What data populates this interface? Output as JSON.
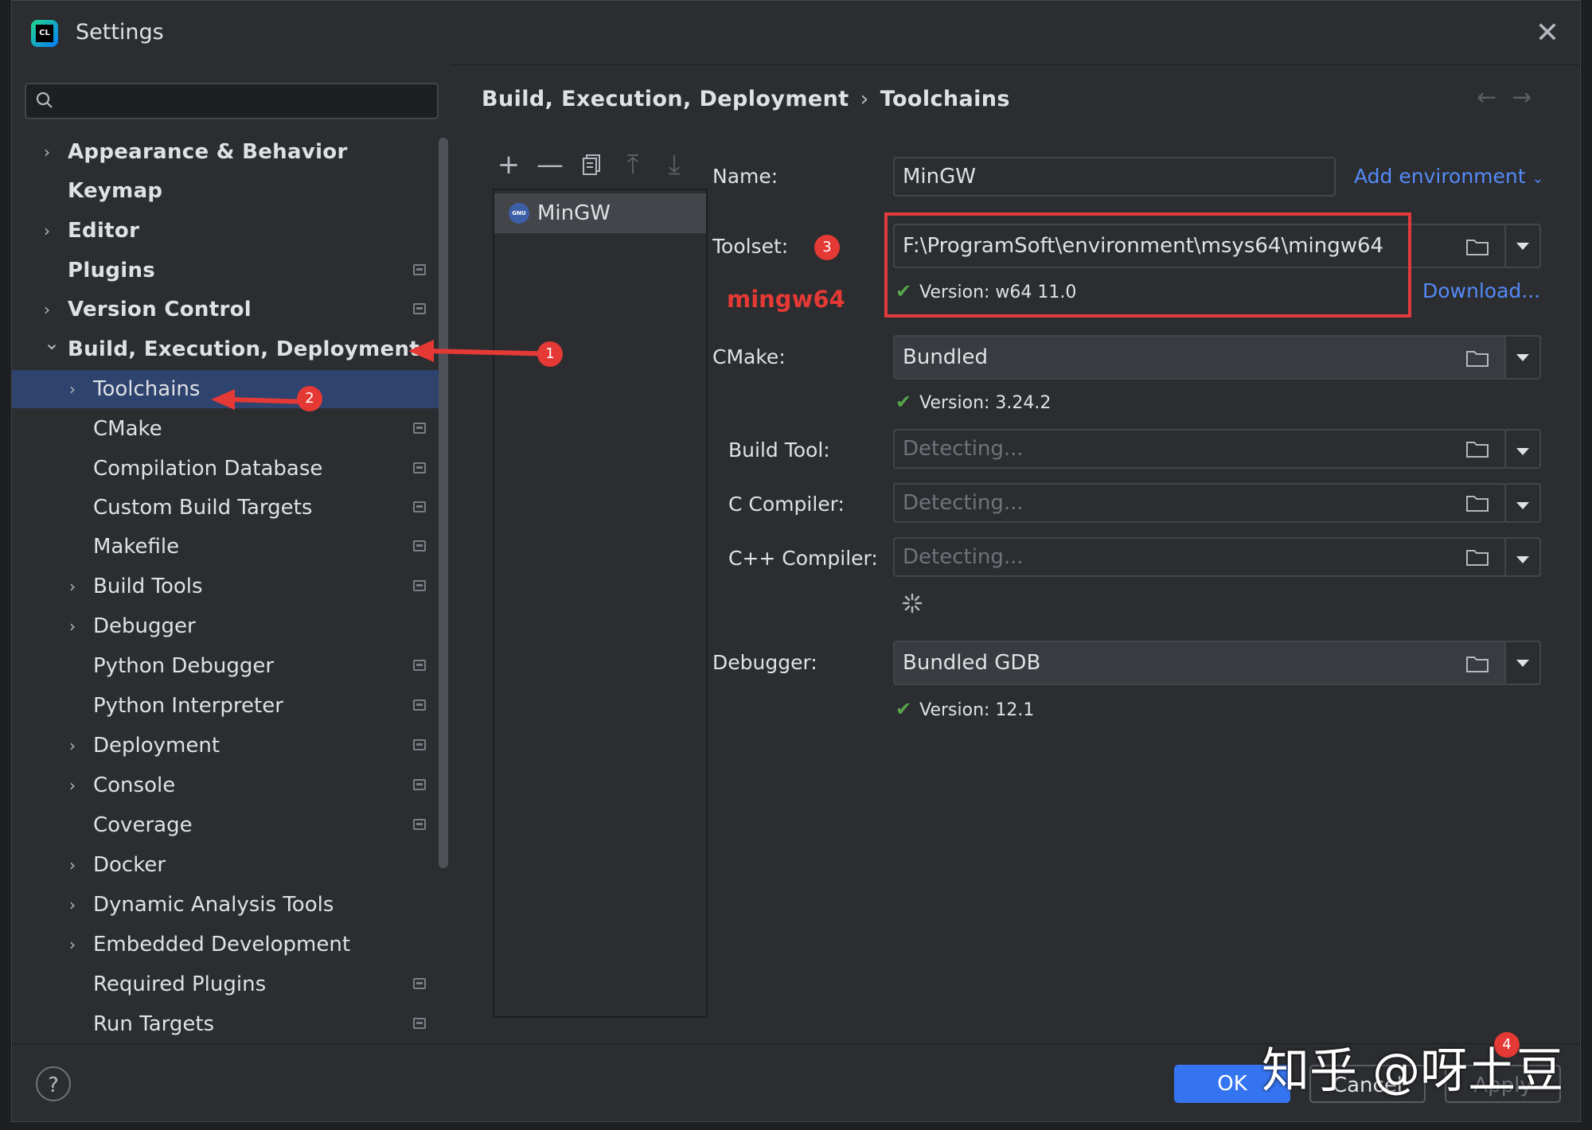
{
  "window": {
    "title": "Settings"
  },
  "search": {
    "placeholder": ""
  },
  "sidebar": {
    "items": [
      {
        "label": "Appearance & Behavior",
        "expandable": true,
        "pinned": false,
        "level": 0
      },
      {
        "label": "Keymap",
        "expandable": false,
        "pinned": false,
        "level": 0
      },
      {
        "label": "Editor",
        "expandable": true,
        "pinned": false,
        "level": 0
      },
      {
        "label": "Plugins",
        "expandable": false,
        "pinned": true,
        "level": 0
      },
      {
        "label": "Version Control",
        "expandable": true,
        "pinned": true,
        "level": 0
      },
      {
        "label": "Build, Execution, Deployment",
        "expandable": true,
        "pinned": false,
        "level": 0,
        "expanded": true
      },
      {
        "label": "Toolchains",
        "expandable": true,
        "pinned": false,
        "level": 1,
        "selected": true
      },
      {
        "label": "CMake",
        "expandable": false,
        "pinned": true,
        "level": 1
      },
      {
        "label": "Compilation Database",
        "expandable": false,
        "pinned": true,
        "level": 1
      },
      {
        "label": "Custom Build Targets",
        "expandable": false,
        "pinned": true,
        "level": 1
      },
      {
        "label": "Makefile",
        "expandable": false,
        "pinned": true,
        "level": 1
      },
      {
        "label": "Build Tools",
        "expandable": true,
        "pinned": true,
        "level": 1
      },
      {
        "label": "Debugger",
        "expandable": true,
        "pinned": false,
        "level": 1
      },
      {
        "label": "Python Debugger",
        "expandable": false,
        "pinned": true,
        "level": 1
      },
      {
        "label": "Python Interpreter",
        "expandable": false,
        "pinned": true,
        "level": 1
      },
      {
        "label": "Deployment",
        "expandable": true,
        "pinned": true,
        "level": 1
      },
      {
        "label": "Console",
        "expandable": true,
        "pinned": true,
        "level": 1
      },
      {
        "label": "Coverage",
        "expandable": false,
        "pinned": true,
        "level": 1
      },
      {
        "label": "Docker",
        "expandable": true,
        "pinned": false,
        "level": 1
      },
      {
        "label": "Dynamic Analysis Tools",
        "expandable": true,
        "pinned": false,
        "level": 1
      },
      {
        "label": "Embedded Development",
        "expandable": true,
        "pinned": false,
        "level": 1
      },
      {
        "label": "Required Plugins",
        "expandable": false,
        "pinned": true,
        "level": 1
      },
      {
        "label": "Run Targets",
        "expandable": false,
        "pinned": true,
        "level": 1
      }
    ]
  },
  "breadcrumb": {
    "parent": "Build, Execution, Deployment",
    "separator": "›",
    "current": "Toolchains"
  },
  "toolchains": {
    "items": [
      {
        "label": "MinGW",
        "badge": "GNU"
      }
    ]
  },
  "form": {
    "name_label": "Name:",
    "name_value": "MinGW",
    "add_env": "Add environment",
    "toolset_label": "Toolset:",
    "toolset_value": "F:\\ProgramSoft\\environment\\msys64\\mingw64",
    "toolset_version": "Version: w64 11.0",
    "download": "Download...",
    "cmake_label": "CMake:",
    "cmake_value": "Bundled",
    "cmake_version": "Version: 3.24.2",
    "build_tool_label": "Build Tool:",
    "build_tool_value": "Detecting...",
    "c_compiler_label": "C Compiler:",
    "c_compiler_value": "Detecting...",
    "cpp_compiler_label": "C++ Compiler:",
    "cpp_compiler_value": "Detecting...",
    "debugger_label": "Debugger:",
    "debugger_value": "Bundled GDB",
    "debugger_version": "Version: 12.1"
  },
  "annotations": {
    "badge1": "1",
    "badge2": "2",
    "badge3": "3",
    "badge4": "4",
    "mingw_note": "mingw64",
    "color": "#e53935"
  },
  "footer": {
    "ok": "OK",
    "cancel": "Cancel",
    "apply": "Apply",
    "help": "?"
  },
  "watermark": "知乎 @呀土豆",
  "colors": {
    "accent": "#3574f0",
    "selection": "#2e436e",
    "link": "#548af7",
    "success": "#57a64a"
  }
}
